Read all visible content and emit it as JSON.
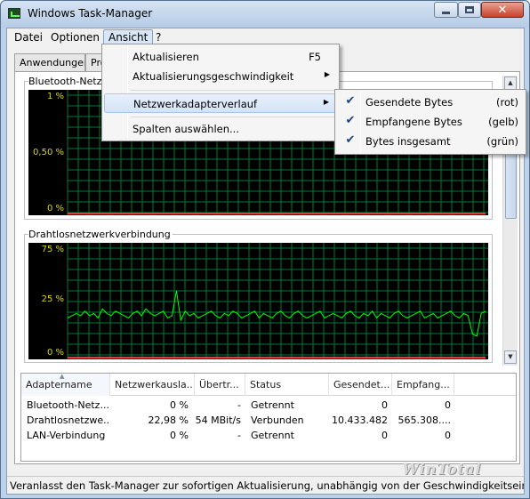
{
  "window": {
    "title": "Windows Task-Manager"
  },
  "menubar": [
    "Datei",
    "Optionen",
    "Ansicht",
    "?"
  ],
  "tabs": [
    "Anwendungen",
    "Pro"
  ],
  "graphs": [
    {
      "label": "Bluetooth-Netzwe",
      "y_labels": [
        "1 %",
        "0,50 %",
        "0 %"
      ]
    },
    {
      "label": "Drahtlosnetzwerkverbindung",
      "y_labels": [
        "75 %",
        "25 %",
        "0 %"
      ]
    }
  ],
  "chart_data": {
    "type": "line",
    "title": "Drahtlosnetzwerkverbindung",
    "ylim": [
      0,
      100
    ],
    "y_ticks": [
      "0 %",
      "25 %",
      "75 %"
    ],
    "grid": true,
    "series": [
      {
        "color": "#00ff00",
        "values": [
          17,
          18,
          19,
          18,
          20,
          18,
          19,
          17,
          21,
          19,
          18,
          20,
          19,
          18,
          17,
          19,
          20,
          18,
          21,
          19,
          18,
          19,
          20,
          17,
          18,
          29,
          16,
          20,
          18,
          19,
          17,
          18,
          19,
          20,
          18,
          17,
          19,
          18,
          20,
          19,
          17,
          18,
          19,
          20,
          17,
          19,
          18,
          17,
          19,
          20,
          18,
          17,
          19,
          20,
          18,
          17,
          18,
          19,
          20,
          17,
          18,
          19,
          18,
          17,
          19,
          20,
          18,
          17,
          19,
          18,
          20,
          17,
          19,
          18,
          17,
          19,
          20,
          18,
          17,
          18,
          19,
          20,
          17,
          18,
          19,
          17,
          18,
          19,
          20,
          18,
          17,
          19,
          18,
          10,
          9,
          19,
          20
        ]
      },
      {
        "color": "#ff3030",
        "values": [
          0,
          0,
          0,
          0,
          0
        ]
      }
    ]
  },
  "list": {
    "columns": [
      "Adaptername",
      "Netzwerkausla...",
      "Übertr...",
      "Status",
      "Gesendet...",
      "Empfang..."
    ],
    "rows": [
      [
        "Bluetooth-Netz...",
        "0 %",
        "-",
        "Getrennt",
        "0",
        "0"
      ],
      [
        "Drahtlosnetzwe...",
        "22,98 %",
        "54 MBit/s",
        "Verbunden",
        "10.433.482",
        "565.308...."
      ],
      [
        "LAN-Verbindung",
        "0 %",
        "-",
        "Getrennt",
        "0",
        "0"
      ]
    ]
  },
  "watermark": "WinTotal",
  "status": "Veranlasst den Task-Manager zur sofortigen Aktualisierung, unabhängig von der Geschwindigkeitseinstellu",
  "ansicht_menu": {
    "items": [
      {
        "label": "Aktualisieren",
        "shortcut": "F5"
      },
      {
        "label": "Aktualisierungsgeschwindigkeit"
      },
      {
        "label": "Netzwerkadapterverlauf"
      },
      {
        "label": "Spalten auswählen..."
      }
    ]
  },
  "submenu": {
    "items": [
      {
        "label": "Gesendete Bytes",
        "color": "(rot)",
        "checked": true
      },
      {
        "label": "Empfangene Bytes",
        "color": "(gelb)",
        "checked": true
      },
      {
        "label": "Bytes insgesamt",
        "color": "(grün)",
        "checked": true
      }
    ]
  }
}
